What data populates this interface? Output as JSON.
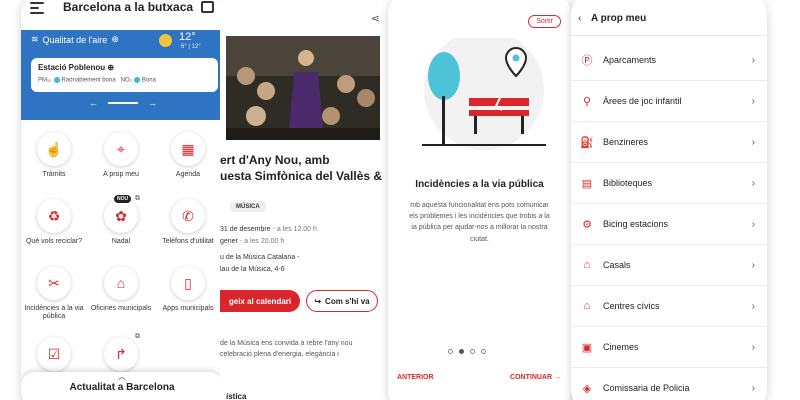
{
  "colors": {
    "accent": "#d9262c",
    "header_blue": "#2f73c3",
    "air_dot": "#3fb8d8",
    "sun": "#f5c33b"
  },
  "screen1": {
    "title": "Barcelona a la butxaca",
    "menu_icon": "hamburger-icon",
    "inbox_icon": "inbox-icon",
    "air_quality_label": "Qualitat de l'aire",
    "temperature": "12°",
    "temperature_range": "6° | 12°",
    "station_name": "Estació Poblenou",
    "station_pm": "PM₁₀",
    "station_pm_value": "Raonablement bona",
    "station_no2": "NO₂",
    "station_no2_value": "Bona",
    "pager_prev": "←",
    "pager_next": "→",
    "tiles": [
      {
        "label": "Tràmits",
        "icon": "hand-pointer-icon",
        "glyph": "☝"
      },
      {
        "label": "A prop meu",
        "icon": "location-pin-icon",
        "glyph": "⌖"
      },
      {
        "label": "Agenda",
        "icon": "calendar-icon",
        "glyph": "▦"
      },
      {
        "label": "Què vols reciclar?",
        "icon": "recycle-icon",
        "glyph": "♻"
      },
      {
        "label": "Nadal",
        "icon": "gift-icon",
        "glyph": "✿",
        "badge": "NOU"
      },
      {
        "label": "Telèfons d'utilitat",
        "icon": "phone-icon",
        "glyph": "✆"
      },
      {
        "label": "Incidències a la via pública",
        "icon": "tools-icon",
        "glyph": "✂"
      },
      {
        "label": "Oficines municipals",
        "icon": "office-pin-icon",
        "glyph": "⌂"
      },
      {
        "label": "Apps municipals",
        "icon": "mobile-app-icon",
        "glyph": "▯"
      },
      {
        "label": "",
        "icon": "checklist-icon",
        "glyph": "☑"
      },
      {
        "label": "",
        "icon": "share-arrow-icon",
        "glyph": "↱"
      }
    ],
    "sheet_title": "Actualitat a Barcelona"
  },
  "screen2": {
    "title_line1": "ert d'Any Nou, amb",
    "title_line2": "uesta Simfònica del Vallès &",
    "tag": "MÚSICA",
    "date1": "31 de desembre",
    "time1": " - a les 12.00 h",
    "date2": "gener",
    "time2": " - a les 20.00 h",
    "venue1": "u de la Música Catalana -",
    "venue2": "lau de la Música, 4-6",
    "calendar_button": "geix al calendari",
    "directions_button": "Com s'hi va",
    "desc1": "de la Música ens convida a rebre l'any nou",
    "desc2": "celebració plena d'energia, elegància i",
    "desc3": "",
    "section": "ística"
  },
  "screen3": {
    "exit_button": "Sortir",
    "title": "Incidències a la via pública",
    "desc1": "mb aquesta funcionalitat ens pots comunicar",
    "desc2": "els problemes i les incidències que trobis a la",
    "desc3": "ia pública per ajudar-nos a millorar la nostra",
    "desc4": "ciutat.",
    "prev": "ANTERIOR",
    "next": "CONTINUAR →",
    "active_dot": 1
  },
  "screen4": {
    "back": "‹",
    "title": "A prop meu",
    "items": [
      {
        "label": "Aparcaments",
        "icon": "parking-icon",
        "glyph": "Ⓟ"
      },
      {
        "label": "Àrees de joc infantil",
        "icon": "playground-icon",
        "glyph": "⚲"
      },
      {
        "label": "Benzineres",
        "icon": "fuel-icon",
        "glyph": "⛽"
      },
      {
        "label": "Biblioteques",
        "icon": "book-icon",
        "glyph": "▤"
      },
      {
        "label": "Bicing estacions",
        "icon": "bicycle-icon",
        "glyph": "⚙"
      },
      {
        "label": "Casals",
        "icon": "casal-icon",
        "glyph": "⌂"
      },
      {
        "label": "Centres cívics",
        "icon": "civic-center-icon",
        "glyph": "⌂"
      },
      {
        "label": "Cinemes",
        "icon": "cinema-icon",
        "glyph": "▣"
      },
      {
        "label": "Comissaria de Policia",
        "icon": "police-icon",
        "glyph": "◈"
      }
    ],
    "chevron": "›"
  }
}
